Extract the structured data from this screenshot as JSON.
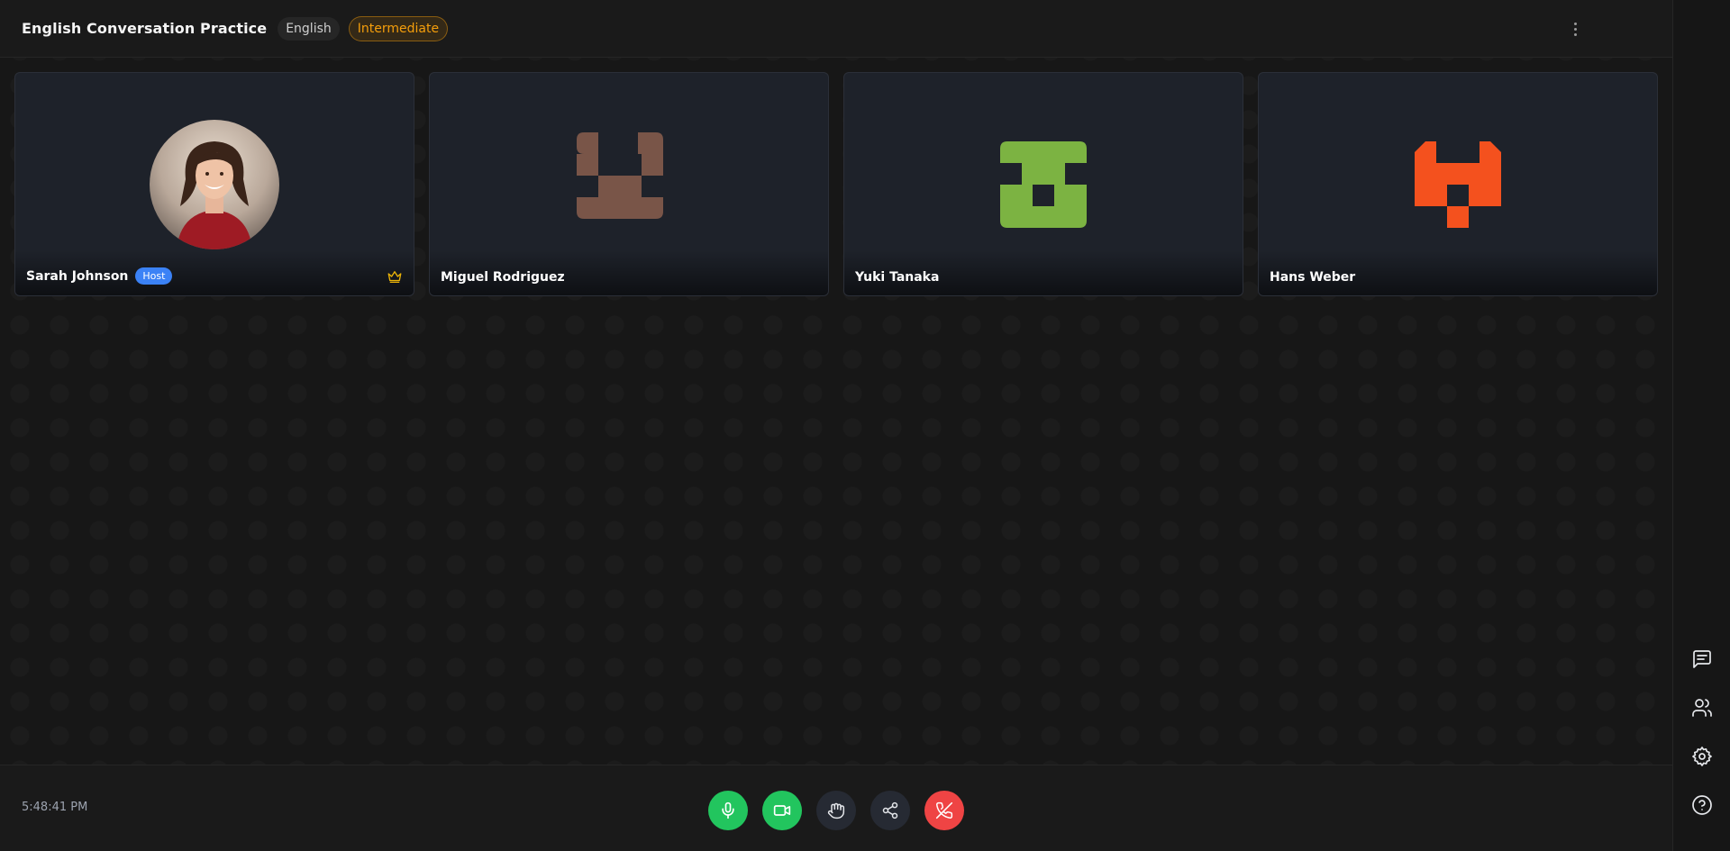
{
  "header": {
    "title": "English Conversation Practice",
    "language": "English",
    "level": "Intermediate",
    "level_color": "#f59e0b"
  },
  "participants": [
    {
      "name": "Sarah Johnson",
      "badge": "Host",
      "avatar": "photo",
      "is_host": true
    },
    {
      "name": "Miguel Rodriguez",
      "avatar": "identicon",
      "avatar_color": "#795548"
    },
    {
      "name": "Yuki Tanaka",
      "avatar": "identicon",
      "avatar_color": "#7cb342"
    },
    {
      "name": "Hans Weber",
      "avatar": "identicon",
      "avatar_color": "#f4511e"
    }
  ],
  "footer": {
    "time": "5:48:41 PM"
  },
  "controls": [
    {
      "icon": "microphone-icon",
      "color": "#22c55e"
    },
    {
      "icon": "video-camera-icon",
      "color": "#22c55e"
    },
    {
      "icon": "raise-hand-icon",
      "color": "#262a33"
    },
    {
      "icon": "share-icon",
      "color": "#262a33"
    },
    {
      "icon": "end-call-icon",
      "color": "#ef4444"
    }
  ],
  "side_rail": [
    "chat-icon",
    "participants-icon",
    "settings-icon",
    "help-icon"
  ],
  "colors": {
    "background": "#171717",
    "tile": "#1e222a",
    "host_badge": "#3b82f6",
    "crown": "#eab308"
  }
}
